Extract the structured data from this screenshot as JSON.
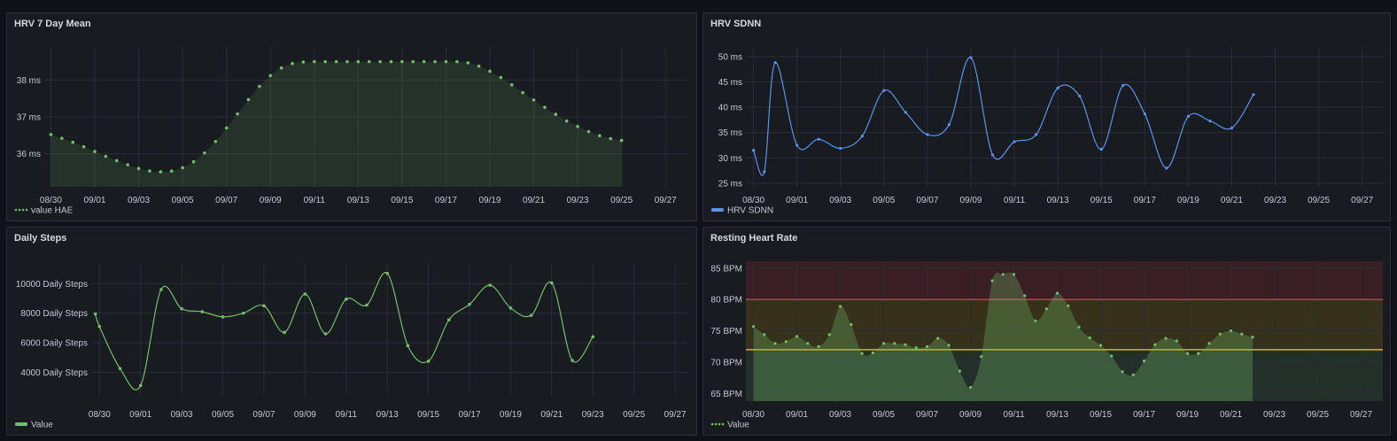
{
  "colors": {
    "background": "#111217",
    "panel": "#181b1f",
    "grid": "#2a2e35",
    "green": "#73bf69",
    "blue": "#5794f2",
    "red_threshold": "#e02f44",
    "yellow_threshold": "#e0b400"
  },
  "panels": {
    "hrv_mean": {
      "title": "HRV 7 Day Mean"
    },
    "hrv_sdnn": {
      "title": "HRV SDNN"
    },
    "steps": {
      "title": "Daily Steps"
    },
    "rhr": {
      "title": "Resting Heart Rate"
    }
  },
  "chart_data": [
    {
      "type": "line",
      "title": "HRV 7 Day Mean",
      "x_tick_labels": [
        "08/30",
        "09/01",
        "09/03",
        "09/05",
        "09/07",
        "09/09",
        "09/11",
        "09/13",
        "09/15",
        "09/17",
        "09/19",
        "09/21",
        "09/23",
        "09/25",
        "09/27"
      ],
      "y_tick_labels": [
        "36 ms",
        "37 ms",
        "38 ms"
      ],
      "y_ticks": [
        36,
        37,
        38
      ],
      "xlim": [
        -0.3,
        29.0
      ],
      "ylim": [
        35.1,
        38.9
      ],
      "area_fill": true,
      "show_points": true,
      "points_style": "dotted",
      "legend": [
        "value HAE"
      ],
      "series": [
        {
          "name": "value HAE",
          "color": "#73bf69",
          "x": [
            0,
            0.5,
            1,
            1.5,
            2,
            2.5,
            3,
            3.5,
            4,
            4.5,
            5,
            5.5,
            6,
            6.5,
            7,
            7.5,
            8,
            8.5,
            9,
            9.5,
            10,
            10.5,
            11,
            11.5,
            12,
            12.5,
            13,
            13.5,
            14,
            14.5,
            15,
            15.5,
            16,
            16.5,
            17,
            17.5,
            18,
            18.5,
            19,
            19.5,
            20,
            20.5,
            21,
            21.5,
            22,
            22.5,
            23,
            23.5,
            24,
            24.5,
            25,
            25.5,
            26
          ],
          "y": [
            36.52,
            36.42,
            36.31,
            36.19,
            36.06,
            35.93,
            35.81,
            35.7,
            35.6,
            35.53,
            35.51,
            35.53,
            35.62,
            35.78,
            36.02,
            36.33,
            36.7,
            37.08,
            37.47,
            37.83,
            38.12,
            38.33,
            38.45,
            38.49,
            38.5,
            38.5,
            38.5,
            38.5,
            38.5,
            38.5,
            38.5,
            38.5,
            38.5,
            38.5,
            38.5,
            38.5,
            38.5,
            38.5,
            38.47,
            38.38,
            38.24,
            38.07,
            37.87,
            37.66,
            37.46,
            37.26,
            37.07,
            36.89,
            36.74,
            36.6,
            36.49,
            36.41,
            36.36
          ]
        }
      ]
    },
    {
      "type": "line",
      "title": "HRV SDNN",
      "x_tick_labels": [
        "08/30",
        "09/01",
        "09/03",
        "09/05",
        "09/07",
        "09/09",
        "09/11",
        "09/13",
        "09/15",
        "09/17",
        "09/19",
        "09/21",
        "09/23",
        "09/25",
        "09/27"
      ],
      "y_tick_labels": [
        "25 ms",
        "30 ms",
        "35 ms",
        "40 ms",
        "45 ms",
        "50 ms"
      ],
      "y_ticks": [
        25,
        30,
        35,
        40,
        45,
        50
      ],
      "xlim": [
        -0.35,
        28.95
      ],
      "ylim": [
        24.3,
        51.9
      ],
      "legend": [
        "HRV SDNN"
      ],
      "series": [
        {
          "name": "HRV SDNN",
          "color": "#5794f2",
          "x": [
            0,
            0.5,
            1,
            2,
            3,
            4,
            5,
            6,
            7,
            8,
            9,
            10,
            11,
            12,
            13,
            14,
            15,
            16,
            17,
            18,
            19,
            20,
            21,
            22,
            23
          ],
          "y": [
            31.5,
            27.3,
            48.8,
            32.5,
            33.7,
            31.9,
            34.3,
            43.3,
            39.0,
            34.6,
            36.6,
            49.8,
            30.6,
            33.2,
            34.6,
            43.8,
            42.2,
            31.7,
            44.3,
            38.7,
            28.0,
            38.2,
            37.3,
            35.9,
            42.5
          ]
        }
      ]
    },
    {
      "type": "line",
      "title": "Daily Steps",
      "x_tick_labels": [
        "08/30",
        "09/01",
        "09/03",
        "09/05",
        "09/07",
        "09/09",
        "09/11",
        "09/13",
        "09/15",
        "09/17",
        "09/19",
        "09/21",
        "09/23",
        "09/25",
        "09/27"
      ],
      "y_tick_labels": [
        "4000 Daily Steps",
        "6000 Daily Steps",
        "8000 Daily Steps",
        "10000 Daily Steps"
      ],
      "y_ticks": [
        4000,
        6000,
        8000,
        10000
      ],
      "xlim": [
        -0.4,
        28.6
      ],
      "ylim": [
        2400,
        11400
      ],
      "legend": [
        "Value"
      ],
      "series": [
        {
          "name": "Value",
          "color": "#73bf69",
          "x": [
            -0.2,
            0,
            1,
            2,
            3,
            4,
            5,
            6,
            7,
            8,
            9,
            10,
            11,
            12,
            13,
            14,
            15,
            16,
            17,
            18,
            19,
            20,
            21,
            22,
            23,
            24
          ],
          "y": [
            7950,
            7100,
            4250,
            3100,
            9600,
            8300,
            8100,
            7750,
            8000,
            8500,
            6700,
            9300,
            6600,
            8950,
            8550,
            10700,
            5800,
            4750,
            7550,
            8600,
            9900,
            8350,
            7850,
            10050,
            4800,
            6400
          ]
        }
      ]
    },
    {
      "type": "area",
      "title": "Resting Heart Rate",
      "x_tick_labels": [
        "08/30",
        "09/01",
        "09/03",
        "09/05",
        "09/07",
        "09/09",
        "09/11",
        "09/13",
        "09/15",
        "09/17",
        "09/19",
        "09/21",
        "09/23",
        "09/25",
        "09/27"
      ],
      "y_tick_labels": [
        "65 BPM",
        "70 BPM",
        "75 BPM",
        "80 BPM",
        "85 BPM"
      ],
      "y_ticks": [
        65,
        70,
        75,
        80,
        85
      ],
      "xlim": [
        -0.35,
        29.0
      ],
      "ylim": [
        63.8,
        86.1
      ],
      "thresholds": [
        72,
        80
      ],
      "threshold_colors": [
        "#73bf69",
        "#e0b400",
        "#e02f44"
      ],
      "show_points": true,
      "points_style": "dotted",
      "legend": [
        "Value"
      ],
      "series": [
        {
          "name": "Value",
          "color": "#73bf69",
          "x": [
            0,
            0.5,
            1,
            1.5,
            2,
            2.5,
            3,
            3.5,
            4,
            4.5,
            5,
            5.5,
            6,
            6.5,
            7,
            7.5,
            8,
            8.5,
            9,
            9.5,
            10,
            10.5,
            11,
            11.5,
            12,
            12.5,
            13,
            13.5,
            14,
            14.5,
            15,
            15.5,
            16,
            16.5,
            17,
            17.5,
            18,
            18.5,
            19,
            19.5,
            20,
            20.5,
            21,
            21.5,
            22,
            22.5,
            23
          ],
          "y": [
            75.7,
            74.4,
            73.0,
            73.3,
            74.1,
            73.0,
            72.5,
            74.4,
            78.9,
            76.0,
            71.4,
            71.5,
            73.0,
            73.0,
            72.8,
            72.3,
            72.5,
            73.8,
            72.7,
            68.6,
            66.0,
            70.9,
            83.0,
            84.0,
            84.0,
            80.6,
            76.6,
            78.5,
            81.0,
            79.0,
            75.6,
            73.9,
            72.7,
            71.0,
            68.5,
            68.0,
            70.2,
            72.8,
            73.8,
            73.4,
            71.4,
            71.4,
            73.0,
            74.5,
            75.0,
            74.5,
            74.0
          ]
        }
      ]
    }
  ]
}
